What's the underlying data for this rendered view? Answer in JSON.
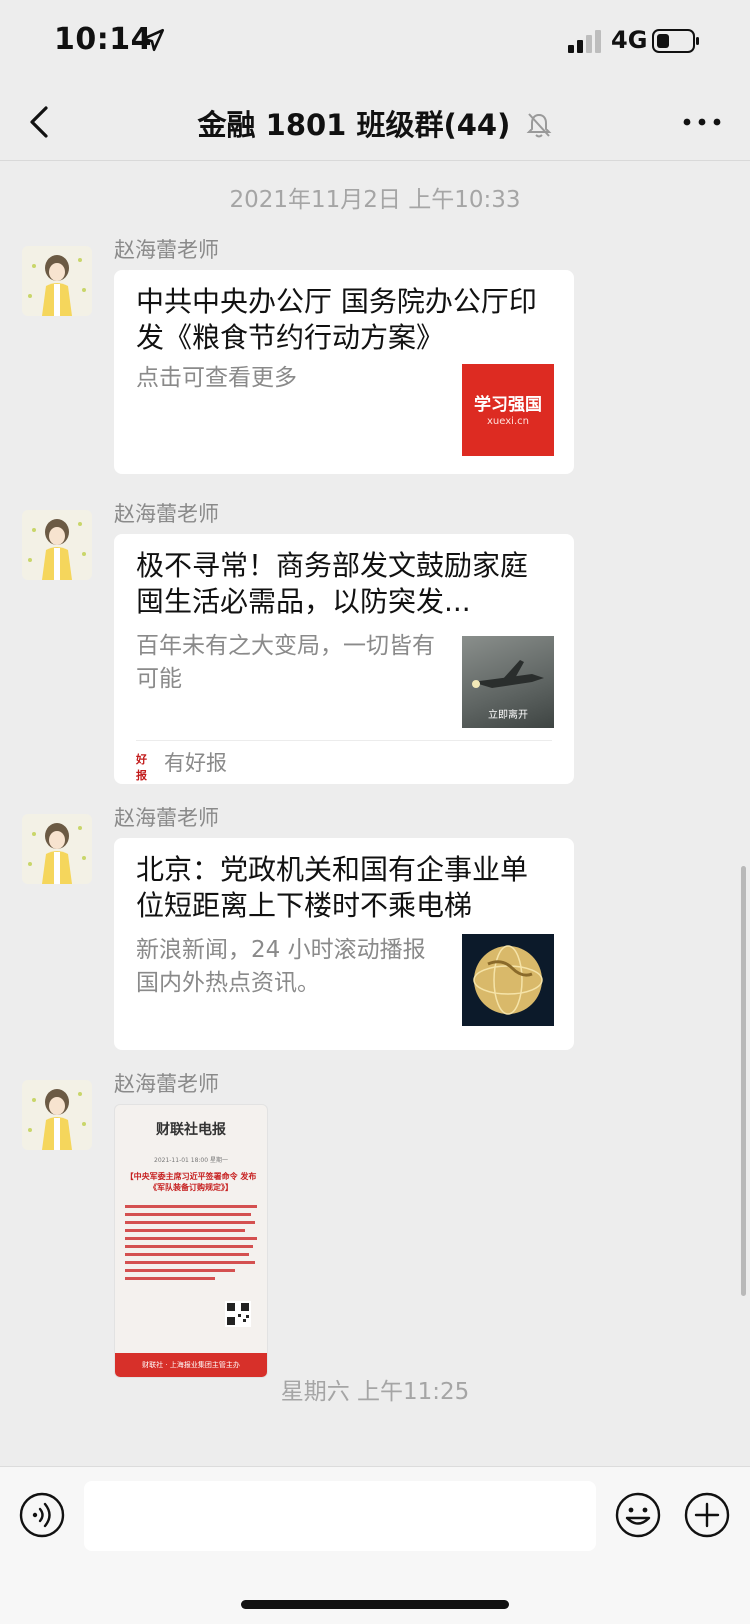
{
  "status_bar": {
    "time": "10:14",
    "network": "4G"
  },
  "nav": {
    "title": "金融 1801 班级群(44)"
  },
  "separators": [
    "2021年11月2日 上午10:33",
    "星期六 上午11:25"
  ],
  "messages": [
    {
      "sender": "赵海蕾老师",
      "title": "中共中央办公厅 国务院办公厅印发《粮食节约行动方案》",
      "desc": "点击可查看更多",
      "thumb_text": "学习强国",
      "thumb_sub": "xuexi.cn"
    },
    {
      "sender": "赵海蕾老师",
      "title": "极不寻常！商务部发文鼓励家庭囤生活必需品，以防突发...",
      "desc": "百年未有之大变局，一切皆有可能",
      "thumb_text": "立即离开",
      "source_icon": "好报",
      "source": "有好报"
    },
    {
      "sender": "赵海蕾老师",
      "title": "北京：党政机关和国有企事业单位短距离上下楼时不乘电梯",
      "desc": "新浪新闻，24 小时滚动播报国内外热点资讯。"
    },
    {
      "sender": "赵海蕾老师",
      "image": {
        "brand": "财联社电报",
        "date": "2021-11-01 18:00 星期一",
        "headline": "【中央军委主席习近平签署命令 发布《军队装备订购规定》】",
        "footer": "财联社 · 上海报业集团主管主办"
      }
    }
  ],
  "input": {
    "placeholder": ""
  }
}
